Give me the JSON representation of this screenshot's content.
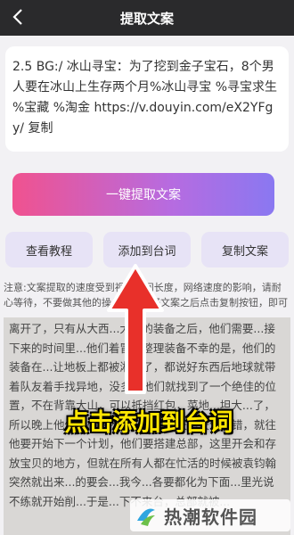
{
  "header": {
    "title": "提取文案"
  },
  "input": {
    "text": "2.5 BG:/ 冰山寻宝：为了挖到金子宝石，8个男人要在冰山上生存两个月%冰山寻宝 %寻宝求生 %宝藏 %淘金 https://v.douyin.com/eX2YFgy/ 复制"
  },
  "buttons": {
    "extract": "一键提取文案",
    "tutorial": "查看教程",
    "add_lines": "添加到台词",
    "copy": "复制文案"
  },
  "note": "注意:文案提取的速度受到视频时间长度，网络速度的影响，请耐心等待，不要做其他的操作，提取好文案之后点击复制按钮，即可",
  "result": {
    "text": "离开了，只有从大西...大体的装备之后，他们需要...接下来的时间里...他们着冒雨整理装备不幸的是，他们的装备在...让地板上都被淋湿了，都说好东西后地球就带着队友着手找异地，没多久他们就找到了一个绝佳的位置，不在背靠大山，可以抵挡红包，菜地...坦大...了，所以晚上他们睡得很不好，不过今天的天气不错，就往他要开始下一个计划，他们要搭建总部，这里开会和存放宝贝的地方，但就在所有人都在忙活的时候被袁钧翰突然就出来...的要会...我今...各要都化为下面...里光说不练就开始削...于是...下不来台，总部就被..."
  },
  "overlay": {
    "caption": "点击添加到台词"
  },
  "watermark": {
    "text": "热潮软件园"
  },
  "colors": {
    "topbar": "#2a2a2c",
    "gradient_start": "#f0528f",
    "gradient_end": "#8a78f1",
    "caption": "#ffe600",
    "arrow": "#e8302a"
  }
}
